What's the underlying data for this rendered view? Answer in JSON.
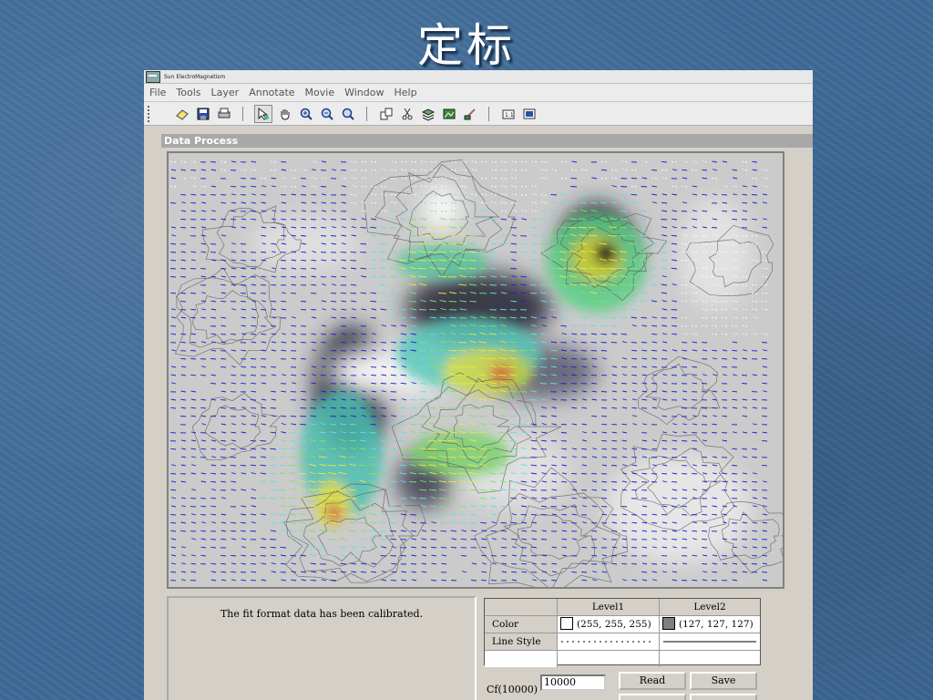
{
  "slide": {
    "title": "定标"
  },
  "window": {
    "title": "Sun ElectroMagnetism"
  },
  "menu": [
    "File",
    "Tools",
    "Layer",
    "Annotate",
    "Movie",
    "Window",
    "Help"
  ],
  "toolbar": {
    "groups": [
      [
        "eraser-icon",
        "save-icon",
        "print-icon"
      ],
      [
        "select-arrow-icon",
        "pan-hand-icon",
        "zoom-in-icon",
        "zoom-out-icon",
        "zoom-fit-icon"
      ],
      [
        "copy-icon",
        "cut-icon",
        "layers-icon",
        "image-icon",
        "brush-icon"
      ],
      [
        "one-to-one-icon",
        "fit-window-icon"
      ]
    ]
  },
  "panel": {
    "title": "Data Process"
  },
  "message": "The fit format data has been calibrated.",
  "levels": {
    "headers": [
      "Level1",
      "Level2"
    ],
    "color_label": "Color",
    "linestyle_label": "Line Style",
    "level1_color_text": "(255, 255, 255)",
    "level1_color_hex": "#ffffff",
    "level2_color_text": "(127, 127, 127)",
    "level2_color_hex": "#7f7f7f"
  },
  "cf": {
    "label": "Cf(10000)",
    "value": "10000"
  },
  "buttons": {
    "read": "Read",
    "save": "Save"
  },
  "colors": {
    "vector_blue": "#2020d0",
    "contour": "#555555",
    "background_slide": "#3e6a98"
  }
}
